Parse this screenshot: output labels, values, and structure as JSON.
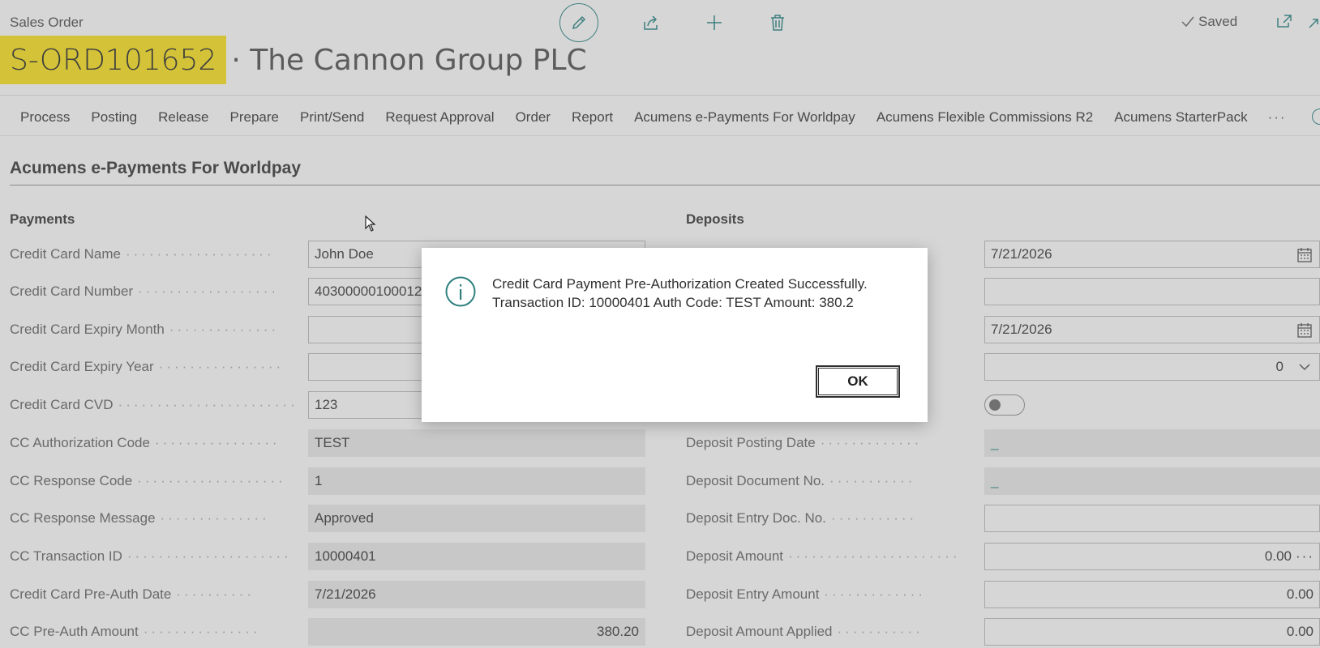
{
  "header": {
    "breadcrumb": "Sales Order",
    "order_no": "S-ORD101652",
    "title_rest": "· The Cannon Group PLC",
    "saved_label": "Saved"
  },
  "toolbar": {
    "actions": [
      "edit-icon",
      "share-icon",
      "plus-icon",
      "delete-icon",
      "popout-icon",
      "collapse-icon"
    ]
  },
  "menu": {
    "items": [
      "Process",
      "Posting",
      "Release",
      "Prepare",
      "Print/Send",
      "Request Approval",
      "Order",
      "Report",
      "Acumens e-Payments For Worldpay",
      "Acumens Flexible Commissions R2",
      "Acumens StarterPack"
    ],
    "more": "···"
  },
  "section": {
    "title": "Acumens e-Payments For Worldpay"
  },
  "payments": {
    "heading": "Payments",
    "fields": [
      {
        "label": "Credit Card Name",
        "value": "John Doe"
      },
      {
        "label": "Credit Card Number",
        "value": "40300000100012"
      },
      {
        "label": "Credit Card Expiry Month",
        "value": ""
      },
      {
        "label": "Credit Card Expiry Year",
        "value": ""
      },
      {
        "label": "Credit Card CVD",
        "value": "123"
      },
      {
        "label": "CC Authorization Code",
        "value": "TEST"
      },
      {
        "label": "CC Response Code",
        "value": "1"
      },
      {
        "label": "CC Response Message",
        "value": "Approved"
      },
      {
        "label": "CC Transaction ID",
        "value": "10000401"
      },
      {
        "label": "Credit Card Pre-Auth Date",
        "value": "7/21/2026"
      },
      {
        "label": "CC Pre-Auth Amount",
        "value": "380.20"
      }
    ]
  },
  "deposits": {
    "heading": "Deposits",
    "fields": [
      {
        "label": "",
        "value": "7/21/2026"
      },
      {
        "label": "",
        "value": ""
      },
      {
        "label": "",
        "value": "7/21/2026"
      },
      {
        "label": "",
        "value": "0"
      },
      {
        "label": "",
        "value": ""
      },
      {
        "label": "Deposit Posting Date",
        "value": "_"
      },
      {
        "label": "Deposit Document No.",
        "value": "_"
      },
      {
        "label": "Deposit Entry Doc. No.",
        "value": ""
      },
      {
        "label": "Deposit Amount",
        "value": "0.00",
        "extra": "···"
      },
      {
        "label": "Deposit Entry Amount",
        "value": "0.00"
      },
      {
        "label": "Deposit Amount Applied",
        "value": "0.00"
      }
    ]
  },
  "dialog": {
    "line1": "Credit Card Payment Pre-Authorization Created Successfully.",
    "line2": "Transaction ID: 10000401 Auth Code: TEST Amount: 380.2",
    "ok_label": "OK"
  },
  "colors": {
    "accent": "#3f7f7f",
    "highlight": "#d4c338",
    "backdrop": "#d6d6d6"
  }
}
